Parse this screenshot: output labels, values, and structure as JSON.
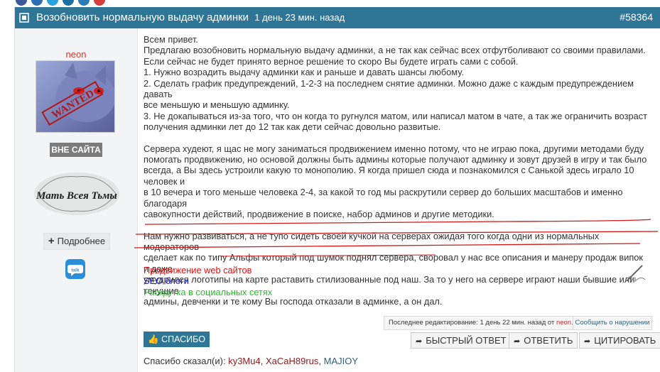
{
  "post": {
    "title": "Возобновить нормальную выдачу админки",
    "time_ago": "1 день 23 мин. назад",
    "number": "#58364"
  },
  "author": {
    "name": "neon",
    "avatar_text": "WANTED",
    "status": "ВНЕ САЙТА",
    "rank_image_text": "Мать Всея Тьмы",
    "more_label": "Подробнее",
    "talk_icon_text": "talk"
  },
  "body": {
    "paragraphs": [
      [
        "Всем привет.",
        "Предлагаю возобновить нормальную выдачу админки, а не так как сейчас всех отфутболивают со своими правилами.",
        "Если сейчас не будет принято верное решение то скоро Вы будете играть сами с собой.",
        "1. Нужно возрадить выдачу админки как и раньше и давать шансы любому.",
        "2. Сделать график предупреждений, 1-2-3 на последнем снятие админки. Можно даже с каждым предупреждением давать",
        "все меньшую и меньшую админку.",
        "3. Не докапываться из-за того, что он когда то ругнулся матом, или написал матом в чате, а так же ограничить возраст",
        "получения админки лет до 12 так как дети сейчас довольно развитые."
      ],
      [
        "Сервера худеют, я щас не могу заниматься продвижением именно потому, что не играю пока, другими методами буду",
        "помогать продвижению, но основой должны быть админы которые получают админку и зовут друзей в игру и так было",
        "всегда, а Вы здесь устроили какую то монополию. Я когда пришел сюда и познакомился с Санькой здесь играло 10 человек и",
        "в 10 вечера и того меньше человека 2-4, за какой то год мы раскрутили сервер до больших масштабов и именно благодаря",
        "савокупности действий, продвижение в поиске, набор админов и другие методики."
      ],
      [
        "Нам нужно развиваться, а не тупо сидеть своей кучкой на серверах ожидая того когда одни из нормальных модераторов",
        "сделает как по типу Альфы который под шумок поднял сервера, своровал у нас все описания и манеру продаж випок и даже",
        "умудрился логотипы на карте раставить стилизованные под наш. За то у него на сервере играют наши бывшие или текущие",
        "админы, девченки и те кому Вы господа отказали в админке, а он дал."
      ]
    ]
  },
  "signature_links": [
    {
      "text": "Продвижение web сайтов",
      "color": "#e01010"
    },
    {
      "text": "SEO блоги",
      "color": "#1a1ac8"
    },
    {
      "text": "Раскрутка в социальных сетях",
      "color": "#2bb82b"
    }
  ],
  "edit_note": {
    "prefix": "Последнее редактирование: 1 день 22 мин. назад от",
    "user": "neon."
  },
  "report_label": "Сообщить о нарушении",
  "actions": {
    "thanks": "СПАСИБО",
    "quick_reply": "БЫСТРЫЙ ОТВЕТ",
    "reply": "ОТВЕТИТЬ",
    "quote": "ЦИТИРОВАТЬ"
  },
  "thanked": {
    "prefix": "Спасибо сказал(и):",
    "users": [
      "ky3Mu4",
      "XaCaH89rus",
      "MAJIOY"
    ]
  },
  "colors": {
    "header": "#2f7595",
    "author": "#d7352a",
    "underline": "#d01818"
  }
}
